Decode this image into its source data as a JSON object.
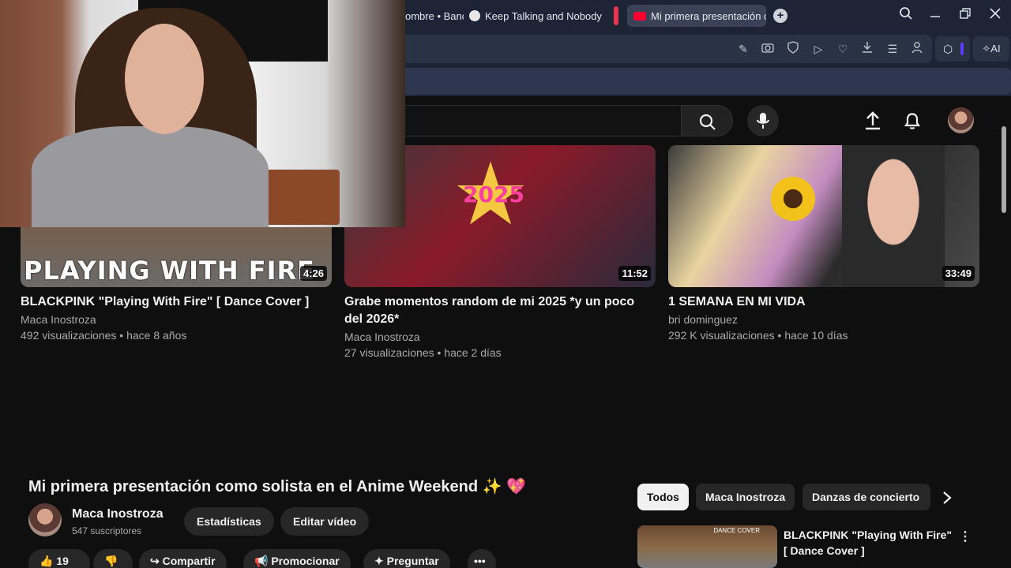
{
  "browser": {
    "tabs": [
      {
        "label": "ombre • Banc",
        "active": false
      },
      {
        "label": "Keep Talking and Nobody",
        "active": false
      },
      {
        "label": "Mi primera presentación c",
        "active": true
      }
    ],
    "new_tab": "+",
    "ai_label": "AI"
  },
  "videos": [
    {
      "title": "BLACKPINK \"Playing With Fire\" [ Dance Cover ]",
      "channel": "Maca Inostroza",
      "meta": "492 visualizaciones • hace 8 años",
      "duration": "4:26",
      "thumb_text": "PLAYING WITH FIRE"
    },
    {
      "title": "Grabe momentos random de mi 2025 *y un poco del 2026*",
      "channel": "Maca Inostroza",
      "meta": "27 visualizaciones • hace 2 días",
      "duration": "11:52",
      "thumb_text": "2025"
    },
    {
      "title": "1 SEMANA EN MI VIDA",
      "channel": "bri dominguez",
      "meta": "292 K visualizaciones • hace 10 días",
      "duration": "33:49",
      "thumb_text": ""
    }
  ],
  "watch": {
    "title": "Mi primera presentación como solista en el Anime Weekend ✨ 💖",
    "channel": "Maca Inostroza",
    "subscribers": "547 suscriptores",
    "buttons": {
      "stats": "Estadísticas",
      "edit": "Editar vídeo"
    },
    "actions": {
      "likes": "19",
      "share": "Compartir",
      "promote": "Promocionar",
      "ask": "Preguntar",
      "more": "•••"
    },
    "chips": [
      "Todos",
      "Maca Inostroza",
      "Danzas de concierto"
    ],
    "related": {
      "title": "BLACKPINK \"Playing With Fire\" [ Dance Cover ]",
      "thumb_label": "DANCE COVER"
    }
  }
}
